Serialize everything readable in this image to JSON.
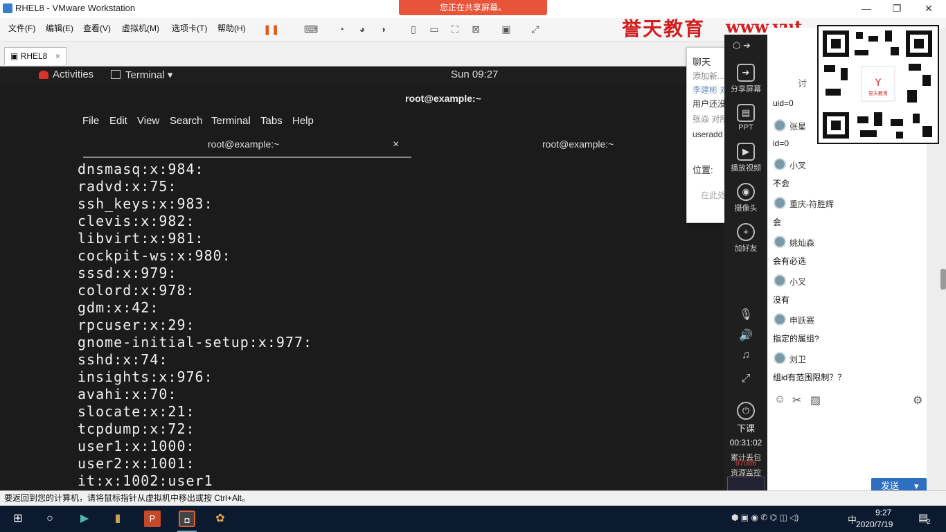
{
  "vmware": {
    "title": "RHEL8 - VMware Workstation",
    "share_banner": "您正在共享屏幕。",
    "menu": [
      "文件(F)",
      "编辑(E)",
      "查看(V)",
      "虚拟机(M)",
      "选项卡(T)",
      "帮助(H)"
    ],
    "tab": "RHEL8",
    "tab_close": "×",
    "status": "要返回到您的计算机，请将鼠标指针从虚拟机中移出或按 Ctrl+Alt。"
  },
  "brand": {
    "name": "誉天教育",
    "url": "www.yut"
  },
  "guest": {
    "activities": "Activities",
    "app_menu": "Terminal ▾",
    "clock": "Sun 09:27",
    "window_title": "root@example:~",
    "terminal_menu": [
      "File",
      "Edit",
      "View",
      "Search",
      "Terminal",
      "Tabs",
      "Help"
    ],
    "tabs": [
      {
        "label": "root@example:~"
      },
      {
        "label": "root@example:~"
      }
    ],
    "tab_close": "×",
    "output": [
      "dnsmasq:x:984:",
      "radvd:x:75:",
      "ssh_keys:x:983:",
      "clevis:x:982:",
      "libvirt:x:981:",
      "cockpit-ws:x:980:",
      "sssd:x:979:",
      "colord:x:978:",
      "gdm:x:42:",
      "rpcuser:x:29:",
      "gnome-initial-setup:x:977:",
      "sshd:x:74:",
      "insights:x:976:",
      "avahi:x:70:",
      "slocate:x:21:",
      "tcpdump:x:72:",
      "user1:x:1000:",
      "user2:x:1001:",
      "it:x:1002:user1"
    ]
  },
  "chat_popup": {
    "title": "聊天",
    "lines": [
      "添加新...",
      "李建彬 对",
      "用户还没",
      "张焱 对所",
      "useradd"
    ],
    "location_label": "位置:",
    "location_hint": "在此处"
  },
  "sidebar": {
    "buttons": [
      "分享屏幕",
      "PPT",
      "播放视频",
      "摄像头",
      "加好友"
    ],
    "end_class": "下课",
    "timer": "00:31:02",
    "stats_label": "累计丢包",
    "stats_value": "97086",
    "monitor": "资源监控"
  },
  "chat": {
    "header": "讨",
    "messages": [
      {
        "name": "",
        "text": "uid=0"
      },
      {
        "name": "张星",
        "text": "id=0"
      },
      {
        "name": "小叉",
        "text": "不会"
      },
      {
        "name": "重庆-符胜辉",
        "text": "会"
      },
      {
        "name": "姚灿森",
        "text": "会有必选"
      },
      {
        "name": "小叉",
        "text": "没有"
      },
      {
        "name": "申跃赛",
        "text": "指定的属组?"
      },
      {
        "name": "刘卫",
        "text": "组id有范围限制？？"
      }
    ],
    "send_label": "发送",
    "qr_label": "誉天教育"
  },
  "taskbar": {
    "tray_input": "中",
    "time": "9:27",
    "date": "2020/7/19",
    "notifications": "2"
  }
}
